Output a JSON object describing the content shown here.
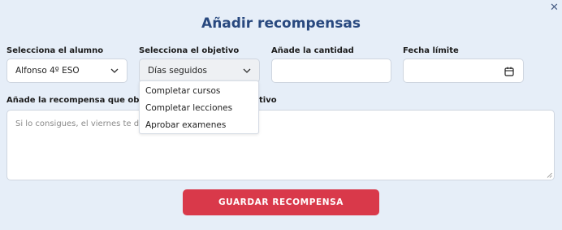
{
  "dialog": {
    "title": "Añadir recompensas",
    "close_icon": "close-icon"
  },
  "student": {
    "label": "Selecciona el alumno",
    "value": "Alfonso 4º ESO",
    "icon": "chevron-down-icon"
  },
  "objective": {
    "label": "Selecciona el objetivo",
    "value": "Días seguidos",
    "icon": "chevron-down-icon",
    "options": [
      "Completar cursos",
      "Completar lecciones",
      "Aprobar examenes"
    ]
  },
  "amount": {
    "label": "Añade la cantidad",
    "value": ""
  },
  "deadline": {
    "label": "Fecha límite",
    "value": "",
    "icon": "calendar-icon"
  },
  "reward": {
    "label_start": "Añade la recompensa que obtend",
    "label_end": "tivo",
    "placeholder": "Si lo consigues, el viernes te doy"
  },
  "save_button": {
    "label": "GUARDAR RECOMPENSA",
    "color": "#d9394a"
  },
  "colors": {
    "background": "#e6eef8",
    "title": "#29497f"
  }
}
